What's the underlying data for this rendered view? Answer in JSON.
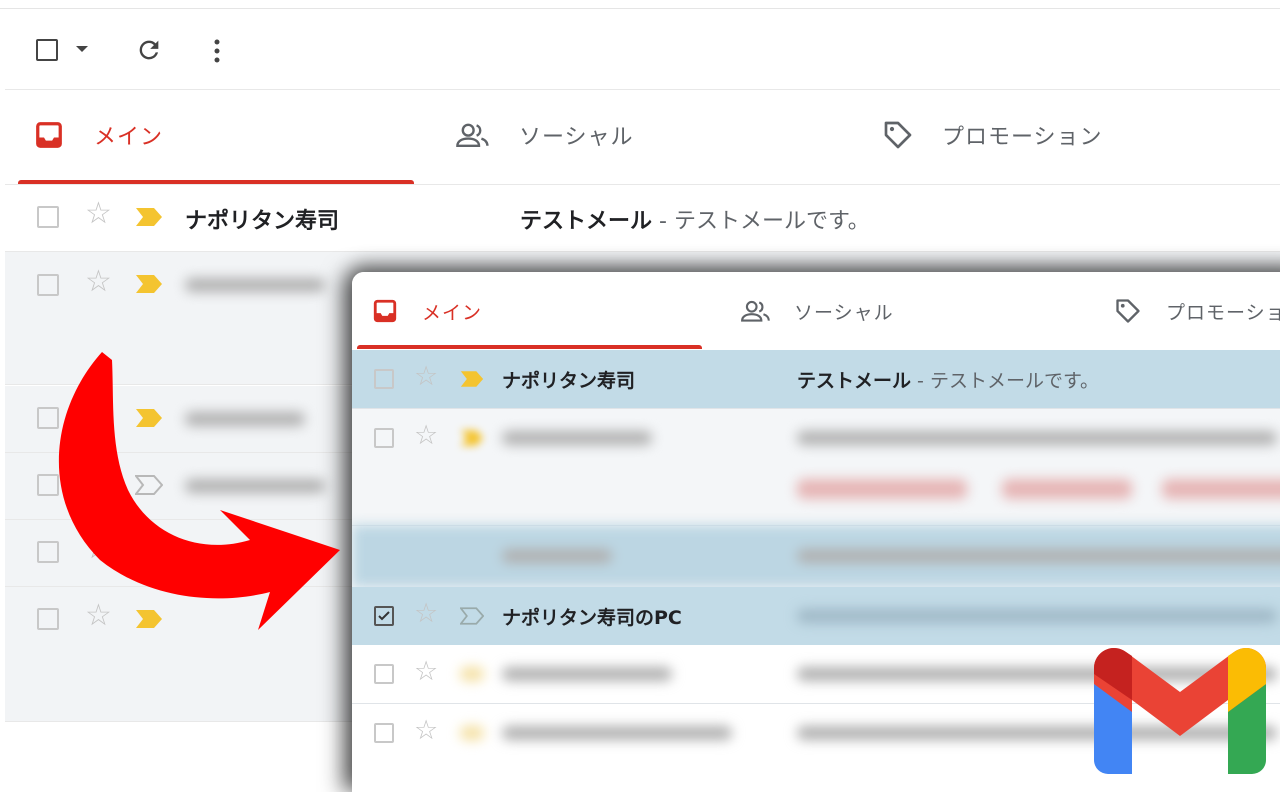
{
  "toolbar": {
    "select_icon": "checkbox-icon",
    "dropdown_icon": "caret-down-icon",
    "refresh_icon": "refresh-icon",
    "more_icon": "more-vert-icon"
  },
  "tabs": [
    {
      "label": "メイン",
      "icon": "inbox-icon",
      "active": true
    },
    {
      "label": "ソーシャル",
      "icon": "people-icon",
      "active": false
    },
    {
      "label": "プロモーション",
      "icon": "tag-icon",
      "active": false
    }
  ],
  "background_rows": [
    {
      "sender": "ナポリタン寿司",
      "subject": "テストメール",
      "snippet": " - テストメールです。",
      "important": true
    }
  ],
  "card": {
    "tabs": [
      {
        "label": "メイン"
      },
      {
        "label": "ソーシャル"
      },
      {
        "label": "プロモーショ"
      }
    ],
    "rows": [
      {
        "sender": "ナポリタン寿司",
        "subject": "テストメール",
        "snippet": " - テストメールです。",
        "highlighted": true,
        "checked": false
      },
      {
        "sender": "ナポリタン寿司のPC",
        "highlighted": true,
        "checked": true
      }
    ]
  },
  "colors": {
    "accent_red": "#d93025",
    "highlight_blue": "#c2dbe7",
    "important_yellow": "#f4c430",
    "arrow_red": "#ff0000"
  },
  "logo": {
    "name": "gmail-logo"
  }
}
